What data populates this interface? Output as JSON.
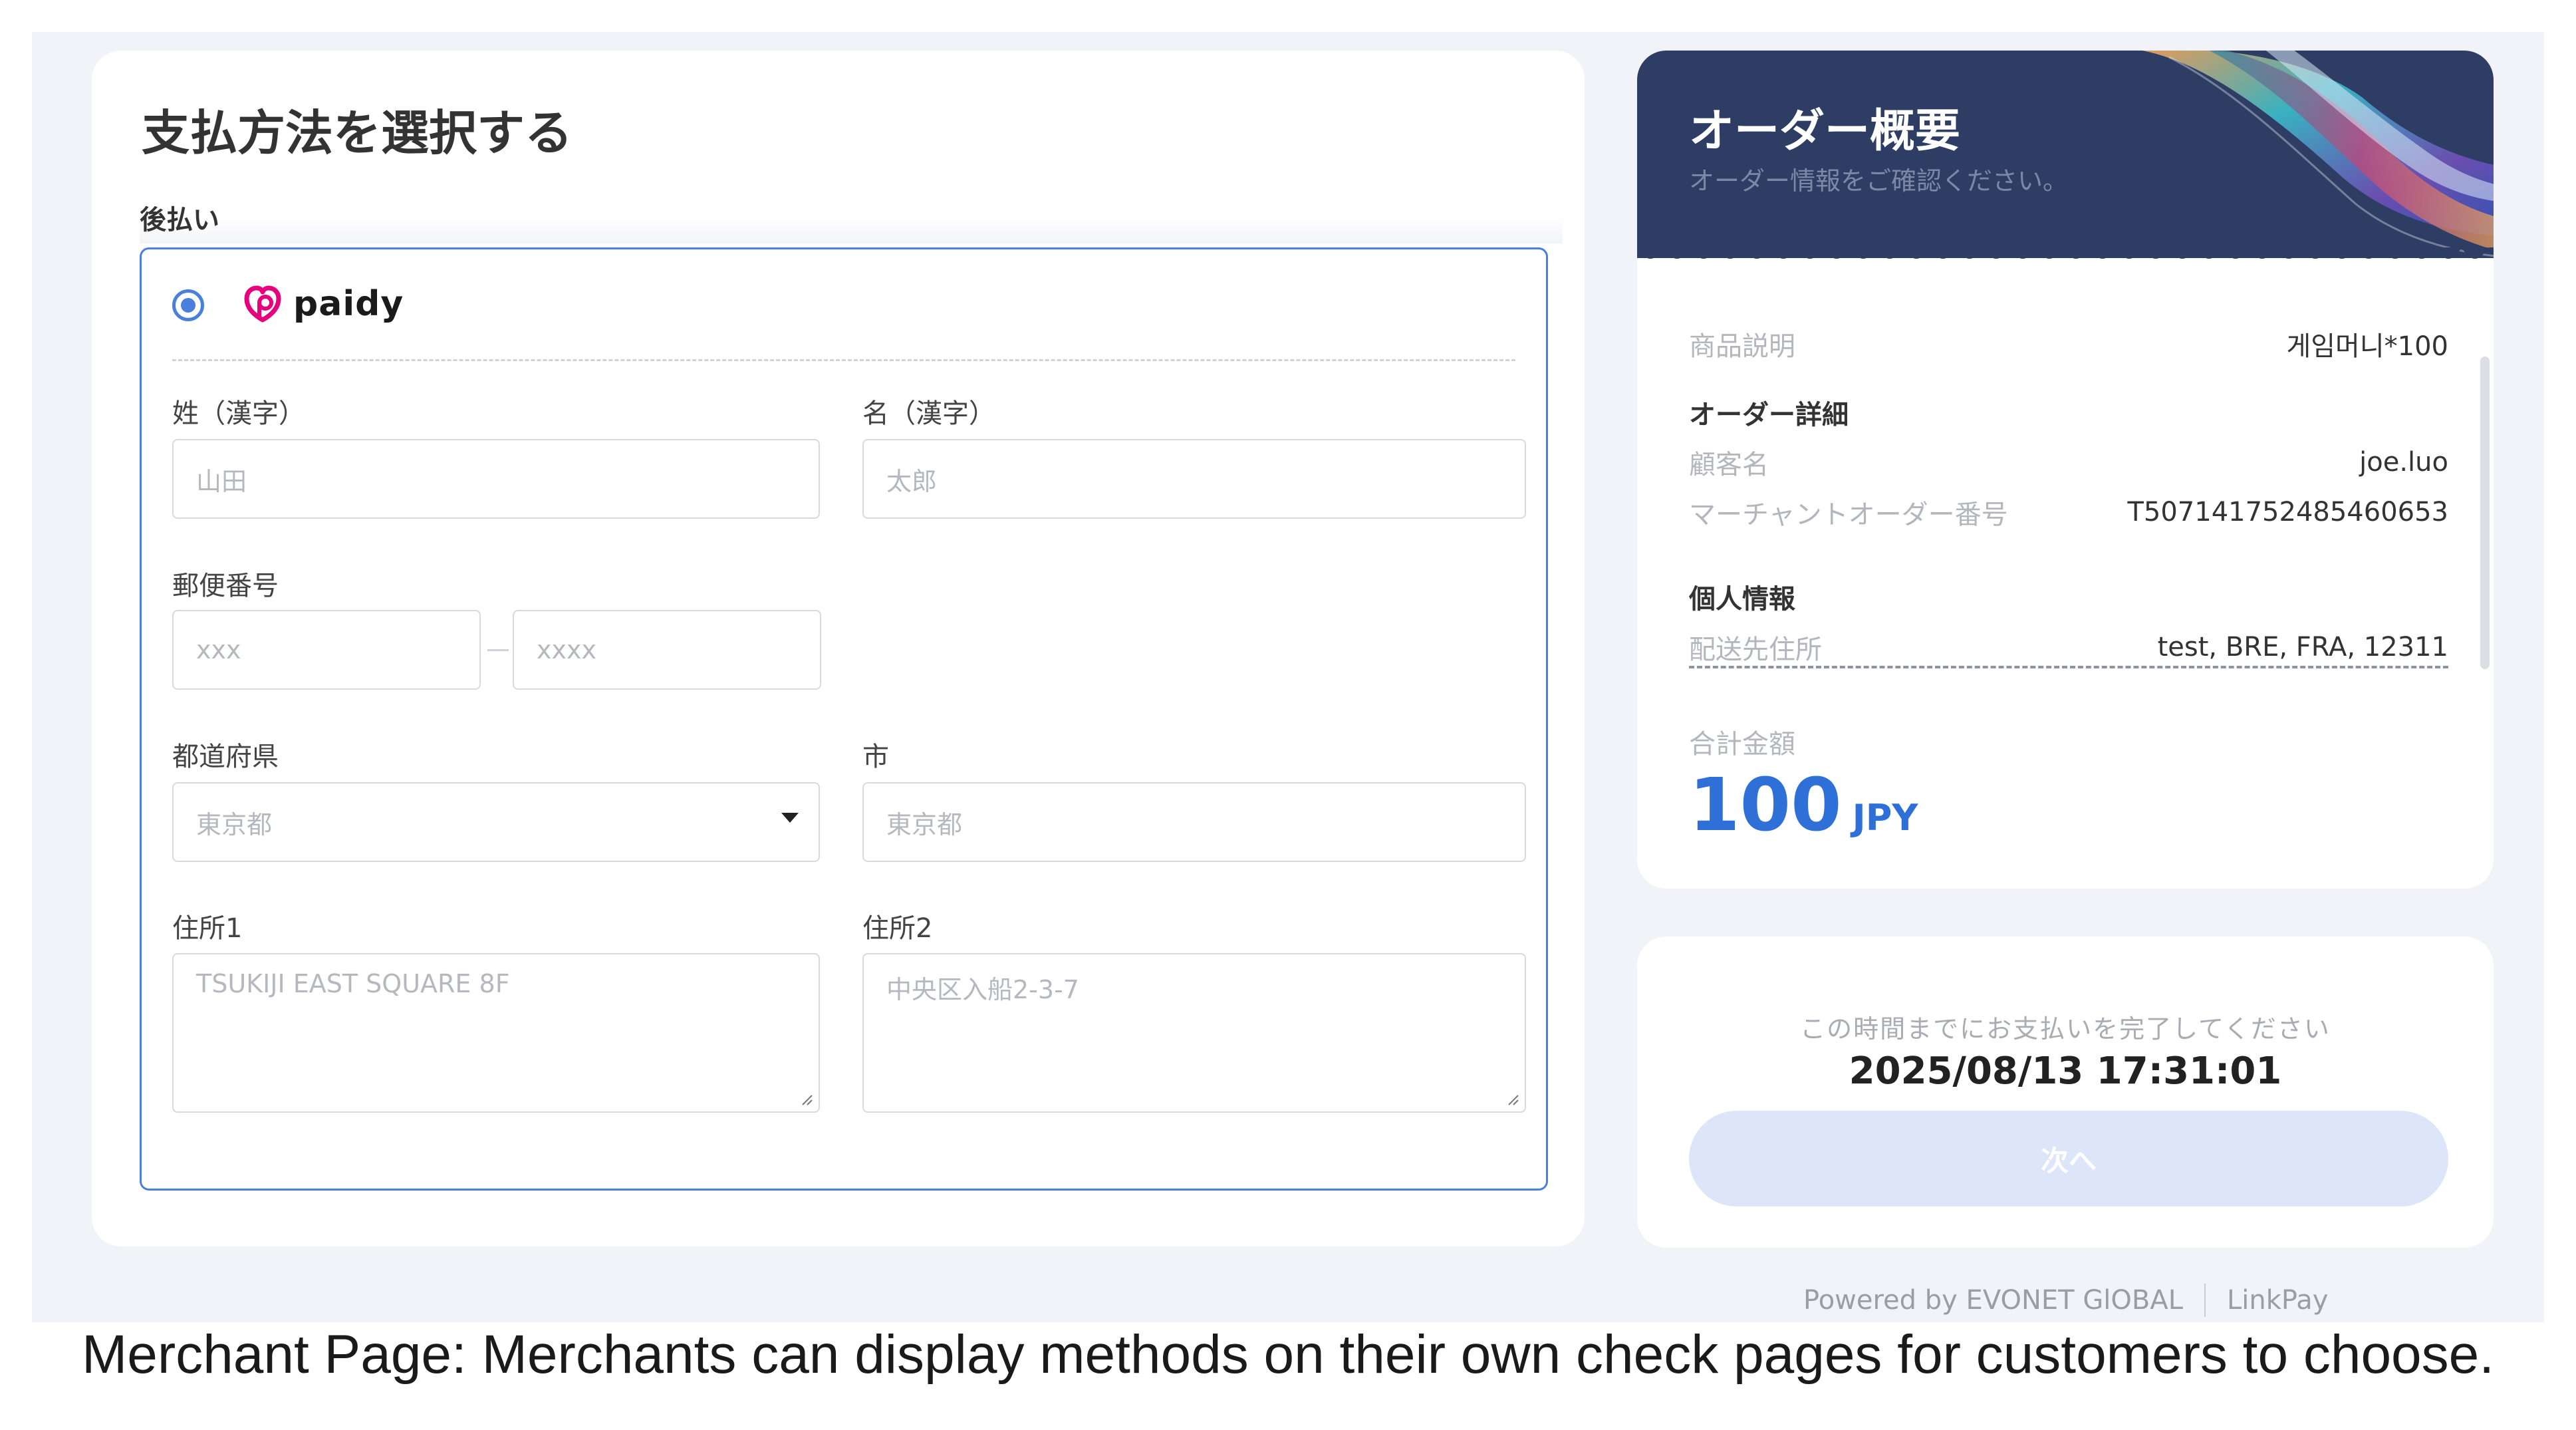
{
  "payment": {
    "title": "支払方法を選択する",
    "section": "後払い",
    "provider": "paidy",
    "fields": {
      "last_name": {
        "label": "姓（漢字）",
        "placeholder": "山田"
      },
      "first_name": {
        "label": "名（漢字）",
        "placeholder": "太郎"
      },
      "postal": {
        "label": "郵便番号",
        "placeholder1": "xxx",
        "placeholder2": "xxxx"
      },
      "prefecture": {
        "label": "都道府県",
        "value": "東京都"
      },
      "city": {
        "label": "市",
        "placeholder": "東京都"
      },
      "address1": {
        "label": "住所1",
        "placeholder": "TSUKIJI EAST SQUARE 8F"
      },
      "address2": {
        "label": "住所2",
        "placeholder": "中央区入船2-3-7"
      }
    }
  },
  "order": {
    "title": "オーダー概要",
    "subtitle": "オーダー情報をご確認ください。",
    "product_label": "商品説明",
    "product_value": "게임머니*100",
    "details_heading": "オーダー詳細",
    "customer_label": "顧客名",
    "customer_value": "joe.luo",
    "merchant_order_label": "マーチャントオーダー番号",
    "merchant_order_value": "T507141752485460653",
    "personal_heading": "個人情報",
    "address_label": "配送先住所",
    "address_value": "test, BRE, FRA, 12311",
    "total_label": "合計金額",
    "total_value": "100",
    "currency": "JPY"
  },
  "action": {
    "deadline_label": "この時間までにお支払いを完了してください",
    "deadline_time": "2025/08/13 17:31:01",
    "next_label": "次へ"
  },
  "footer": {
    "powered_by": "Powered by EVONET GlOBAL",
    "product": "LinkPay"
  },
  "caption": "Merchant Page: Merchants can display methods on their own check pages for customers to choose.",
  "colors": {
    "accent": "#2f6fd8",
    "header_bg": "#2e3d64",
    "selected_border": "#4a7fdc",
    "paidy": "#e6007e",
    "button_disabled": "#dde6f8"
  }
}
